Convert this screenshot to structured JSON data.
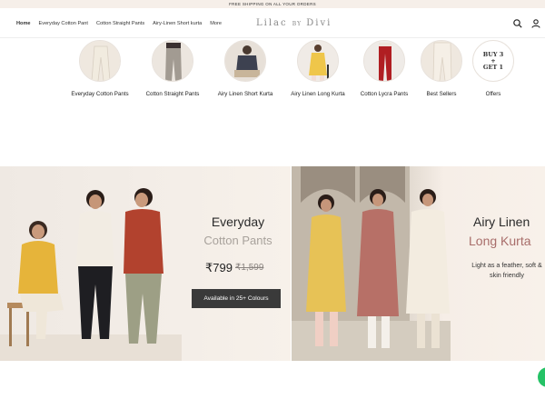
{
  "announcement": "FREE SHIPPING ON ALL YOUR ORDERS",
  "nav": {
    "items": [
      "Home",
      "Everyday Cotton Pant",
      "Cotton Straight Pants",
      "Airy-Linen Short kurta",
      "More"
    ],
    "logo_main": "Lilac",
    "logo_by": "BY",
    "logo_brand": "Divi"
  },
  "header_icons": [
    "search-icon",
    "user-icon"
  ],
  "categories": [
    {
      "label": "Everyday Cotton Pants"
    },
    {
      "label": "Cotton Straight Pants"
    },
    {
      "label": "Airy Linen Short Kurta"
    },
    {
      "label": "Airy Linen Long Kurta"
    },
    {
      "label": "Cotton Lycra Pants"
    },
    {
      "label": "Best Sellers"
    },
    {
      "label": "Offers"
    }
  ],
  "offer_badge": {
    "line1": "BUY 3",
    "line2": "+",
    "line3": "GET 1"
  },
  "banner_left": {
    "title": "Everyday",
    "subtitle": "Cotton Pants",
    "price": "₹799",
    "old_price": "₹1,599",
    "button": "Available in 25+ Colours"
  },
  "banner_right": {
    "title": "Airy Linen",
    "subtitle": "Long Kurta",
    "description": "Light as a feather, soft & skin friendly"
  },
  "colors": {
    "accent_text": "#a86d6a",
    "muted_text": "#a8a29c",
    "button_bg": "#3a3a3a",
    "chat_fab": "#25c266"
  }
}
